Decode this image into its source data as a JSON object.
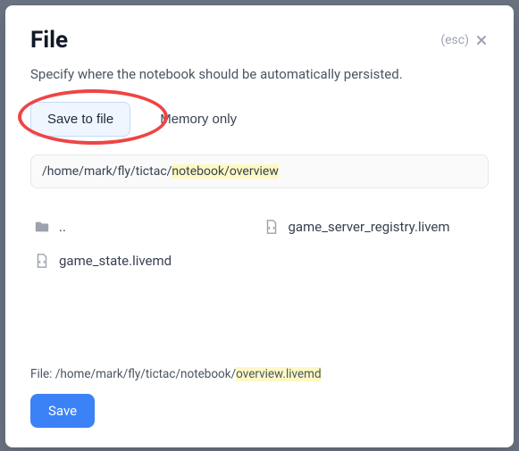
{
  "header": {
    "title": "File",
    "esc_label": "(esc)",
    "subtitle": "Specify where the notebook should be automatically persisted."
  },
  "tabs": {
    "save_to_file": "Save to file",
    "memory_only": "Memory only"
  },
  "path": {
    "prefix": "/home/mark/fly/tictac/",
    "suffix": "notebook/overview"
  },
  "files": {
    "parent_dir": "..",
    "registry": "game_server_registry.livem",
    "state": "game_state.livemd"
  },
  "footer": {
    "label_prefix": "File: ",
    "path_prefix": "/home/mark/fly/tictac/notebook/",
    "path_suffix": "overview.livemd",
    "save_label": "Save"
  }
}
